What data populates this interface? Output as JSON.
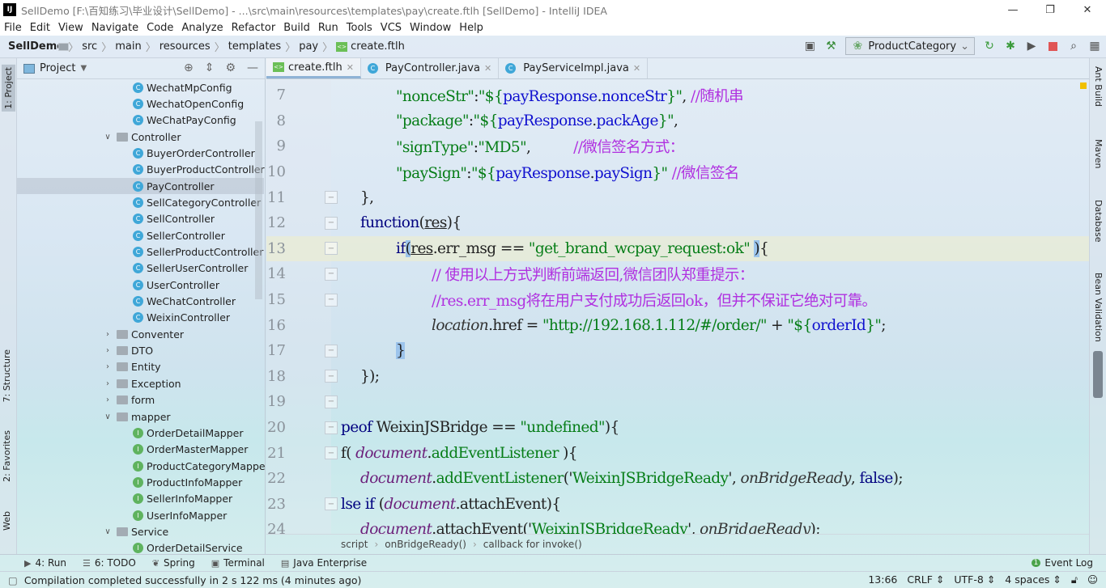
{
  "window": {
    "title": "SellDemo [F:\\百知练习\\毕业设计\\SellDemo] - ...\\src\\main\\resources\\templates\\pay\\create.ftlh [SellDemo] - IntelliJ IDEA",
    "logo": "IJ"
  },
  "menu": [
    "File",
    "Edit",
    "View",
    "Navigate",
    "Code",
    "Analyze",
    "Refactor",
    "Build",
    "Run",
    "Tools",
    "VCS",
    "Window",
    "Help"
  ],
  "breadcrumb": [
    "SellDemo",
    "src",
    "main",
    "resources",
    "templates",
    "pay",
    "create.ftlh"
  ],
  "run_config": "ProductCategory",
  "left_tabs": [
    "1: Project",
    "7: Structure",
    "2: Favorites",
    "Web"
  ],
  "right_tabs": [
    "Ant Build",
    "Maven",
    "Database",
    "Bean Validation"
  ],
  "project_panel": {
    "title": "Project"
  },
  "tree": [
    {
      "label": "WechatMpConfig",
      "type": "class",
      "level": 2
    },
    {
      "label": "WechatOpenConfig",
      "type": "class",
      "level": 2
    },
    {
      "label": "WeChatPayConfig",
      "type": "class",
      "level": 2
    },
    {
      "label": "Controller",
      "type": "folder",
      "level": 1,
      "open": true
    },
    {
      "label": "BuyerOrderController",
      "type": "class",
      "level": 2
    },
    {
      "label": "BuyerProductController",
      "type": "class",
      "level": 2
    },
    {
      "label": "PayController",
      "type": "class",
      "level": 2,
      "selected": true
    },
    {
      "label": "SellCategoryController",
      "type": "class",
      "level": 2
    },
    {
      "label": "SellController",
      "type": "class",
      "level": 2
    },
    {
      "label": "SellerController",
      "type": "class",
      "level": 2
    },
    {
      "label": "SellerProductController",
      "type": "class",
      "level": 2
    },
    {
      "label": "SellerUserController",
      "type": "class",
      "level": 2
    },
    {
      "label": "UserController",
      "type": "class",
      "level": 2
    },
    {
      "label": "WeChatController",
      "type": "class",
      "level": 2
    },
    {
      "label": "WeixinController",
      "type": "class",
      "level": 2
    },
    {
      "label": "Conventer",
      "type": "folder",
      "level": 1
    },
    {
      "label": "DTO",
      "type": "folder",
      "level": 1
    },
    {
      "label": "Entity",
      "type": "folder",
      "level": 1
    },
    {
      "label": "Exception",
      "type": "folder",
      "level": 1
    },
    {
      "label": "form",
      "type": "folder",
      "level": 1
    },
    {
      "label": "mapper",
      "type": "folder",
      "level": 1,
      "open": true
    },
    {
      "label": "OrderDetailMapper",
      "type": "interface",
      "level": 2
    },
    {
      "label": "OrderMasterMapper",
      "type": "interface",
      "level": 2
    },
    {
      "label": "ProductCategoryMapper",
      "type": "interface",
      "level": 2
    },
    {
      "label": "ProductInfoMapper",
      "type": "interface",
      "level": 2
    },
    {
      "label": "SellerInfoMapper",
      "type": "interface",
      "level": 2
    },
    {
      "label": "UserInfoMapper",
      "type": "interface",
      "level": 2
    },
    {
      "label": "Service",
      "type": "folder",
      "level": 1,
      "open": true
    },
    {
      "label": "OrderDetailService",
      "type": "interface",
      "level": 2
    }
  ],
  "tabs": [
    {
      "label": "create.ftlh",
      "icon": "ftl",
      "active": true
    },
    {
      "label": "PayController.java",
      "icon": "class"
    },
    {
      "label": "PayServiceImpl.java",
      "icon": "class"
    }
  ],
  "code": [
    {
      "n": "7",
      "indent": 160,
      "t": [
        [
          "\"nonceStr\"",
          "str"
        ],
        [
          ":",
          "pun"
        ],
        [
          "\"${",
          "str"
        ],
        [
          "payResponse",
          "var"
        ],
        [
          ".",
          "pun"
        ],
        [
          "nonceStr",
          "var"
        ],
        [
          "}\"",
          "str"
        ],
        [
          ", ",
          "pun"
        ],
        [
          "//随机串",
          "cmt"
        ]
      ]
    },
    {
      "n": "8",
      "indent": 160,
      "t": [
        [
          "\"package\"",
          "str"
        ],
        [
          ":",
          "pun"
        ],
        [
          "\"${",
          "str"
        ],
        [
          "payResponse",
          "var"
        ],
        [
          ".",
          "pun"
        ],
        [
          "packAge",
          "var"
        ],
        [
          "}\"",
          "str"
        ],
        [
          ",",
          "pun"
        ]
      ]
    },
    {
      "n": "9",
      "indent": 160,
      "t": [
        [
          "\"signType\"",
          "str"
        ],
        [
          ":",
          "pun"
        ],
        [
          "\"MD5\"",
          "str"
        ],
        [
          ",          ",
          "pun"
        ],
        [
          "//微信签名方式：",
          "cmt"
        ]
      ]
    },
    {
      "n": "10",
      "indent": 160,
      "t": [
        [
          "\"paySign\"",
          "str"
        ],
        [
          ":",
          "pun"
        ],
        [
          "\"${",
          "str"
        ],
        [
          "payResponse",
          "var"
        ],
        [
          ".",
          "pun"
        ],
        [
          "paySign",
          "var"
        ],
        [
          "}\"",
          "str"
        ],
        [
          " //微信签名",
          "cmt"
        ]
      ]
    },
    {
      "n": "11",
      "indent": 116,
      "fold": true,
      "t": [
        [
          "},",
          "pun"
        ]
      ]
    },
    {
      "n": "12",
      "indent": 116,
      "fold": true,
      "t": [
        [
          "function",
          "key"
        ],
        [
          "(",
          "pun"
        ],
        [
          "res",
          "und"
        ],
        [
          "){",
          "pun"
        ]
      ]
    },
    {
      "n": "13",
      "indent": 160,
      "fold": true,
      "cur": true,
      "t": [
        [
          "if",
          "key"
        ],
        [
          "(",
          "hl"
        ],
        [
          "res",
          "und"
        ],
        [
          ".err_msg == ",
          "pun"
        ],
        [
          "\"get_brand_wcpay_request:ok\"",
          "str"
        ],
        [
          " ",
          "pun"
        ],
        [
          ")",
          "hl"
        ],
        [
          "{",
          "pun"
        ]
      ]
    },
    {
      "n": "14",
      "indent": 204,
      "fold": true,
      "t": [
        [
          "// 使用以上方式判断前端返回,微信团队郑重提示：",
          "cmt"
        ]
      ]
    },
    {
      "n": "15",
      "indent": 204,
      "fold": true,
      "t": [
        [
          "//res.err_msg将在用户支付成功后返回ok，但并不保证它绝对可靠。",
          "cmt"
        ]
      ]
    },
    {
      "n": "16",
      "indent": 204,
      "t": [
        [
          "location",
          "ital"
        ],
        [
          ".href = ",
          "pun"
        ],
        [
          "\"http://192.168.1.112/#/order/\"",
          "str"
        ],
        [
          " + ",
          "pun"
        ],
        [
          "\"${",
          "str"
        ],
        [
          "orderId",
          "var"
        ],
        [
          "}\"",
          "str"
        ],
        [
          ";",
          "pun"
        ]
      ]
    },
    {
      "n": "17",
      "indent": 160,
      "fold": true,
      "t": [
        [
          "}",
          "hl"
        ]
      ]
    },
    {
      "n": "18",
      "indent": 116,
      "fold": true,
      "t": [
        [
          "});",
          "pun"
        ]
      ]
    },
    {
      "n": "19",
      "indent": 116,
      "fold": true,
      "t": []
    },
    {
      "n": "20",
      "indent": 92,
      "fold": true,
      "t": [
        [
          "peof ",
          "key"
        ],
        [
          "WeixinJSBridge",
          "pun"
        ],
        [
          " == ",
          "pun"
        ],
        [
          "\"undefined\"",
          "str"
        ],
        [
          "){",
          "pun"
        ]
      ]
    },
    {
      "n": "21",
      "indent": 92,
      "fold": true,
      "t": [
        [
          "f( ",
          "pun"
        ],
        [
          "document",
          "glob"
        ],
        [
          ".",
          "pun"
        ],
        [
          "addEventListener",
          "str"
        ],
        [
          " ){",
          "pun"
        ]
      ]
    },
    {
      "n": "22",
      "indent": 116,
      "t": [
        [
          "document",
          "glob"
        ],
        [
          ".",
          "pun"
        ],
        [
          "addEventListener",
          "str"
        ],
        [
          "('",
          "pun"
        ],
        [
          "WeixinJSBridgeReady",
          "str"
        ],
        [
          "', ",
          "pun"
        ],
        [
          "onBridgeReady",
          "ital"
        ],
        [
          ", ",
          "pun"
        ],
        [
          "false",
          "key"
        ],
        [
          ");",
          "pun"
        ]
      ]
    },
    {
      "n": "23",
      "indent": 92,
      "fold": true,
      "t": [
        [
          "lse ",
          "key"
        ],
        [
          "if ",
          "key"
        ],
        [
          "(",
          "pun"
        ],
        [
          "document",
          "glob"
        ],
        [
          ".",
          "pun"
        ],
        [
          "attachEvent",
          "pun"
        ],
        [
          "){",
          "pun"
        ]
      ]
    },
    {
      "n": "24",
      "indent": 116,
      "t": [
        [
          "document",
          "glob"
        ],
        [
          ".",
          "pun"
        ],
        [
          "attachEvent",
          "pun"
        ],
        [
          "('",
          "pun"
        ],
        [
          "WeixinJSBridgeReady",
          "str"
        ],
        [
          "', ",
          "pun"
        ],
        [
          "onBridgeReady",
          "ital"
        ],
        [
          ");",
          "pun"
        ]
      ]
    }
  ],
  "editor_breadcrumb": [
    "script",
    "onBridgeReady()",
    "callback for invoke()"
  ],
  "tool_windows": [
    "4: Run",
    "6: TODO",
    "Spring",
    "Terminal",
    "Java Enterprise"
  ],
  "event_log": {
    "label": "Event Log",
    "count": "1"
  },
  "status": {
    "message": "Compilation completed successfully in 2 s 122 ms (4 minutes ago)",
    "position": "13:66",
    "line_sep": "CRLF",
    "encoding": "UTF-8",
    "indent": "4 spaces"
  }
}
